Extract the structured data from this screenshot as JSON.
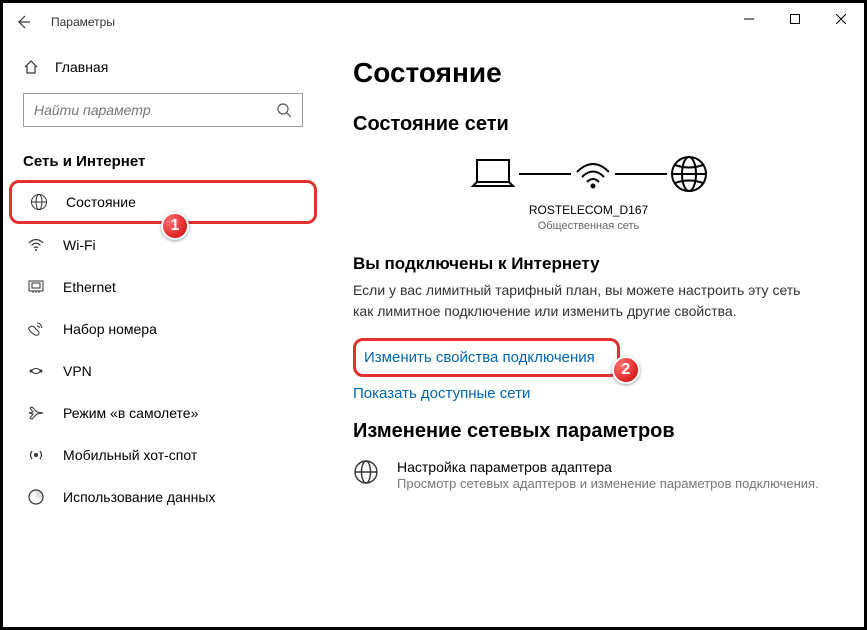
{
  "titlebar": {
    "title": "Параметры"
  },
  "sidebar": {
    "home": "Главная",
    "search_placeholder": "Найти параметр",
    "category": "Сеть и Интернет",
    "items": [
      {
        "label": "Состояние"
      },
      {
        "label": "Wi-Fi"
      },
      {
        "label": "Ethernet"
      },
      {
        "label": "Набор номера"
      },
      {
        "label": "VPN"
      },
      {
        "label": "Режим «в самолете»"
      },
      {
        "label": "Мобильный хот-спот"
      },
      {
        "label": "Использование данных"
      }
    ]
  },
  "main": {
    "page_title": "Состояние",
    "section_status": "Состояние сети",
    "network_name": "ROSTELECOM_D167",
    "network_type": "Общественная сеть",
    "connected_title": "Вы подключены к Интернету",
    "connected_desc": "Если у вас лимитный тарифный план, вы можете настроить эту сеть как лимитное подключение или изменить другие свойства.",
    "link_change_props": "Изменить свойства подключения",
    "link_show_nets": "Показать доступные сети",
    "section_change": "Изменение сетевых параметров",
    "adapter_title": "Настройка параметров адаптера",
    "adapter_desc": "Просмотр сетевых адаптеров и изменение параметров подключения."
  },
  "badges": {
    "one": "1",
    "two": "2"
  }
}
